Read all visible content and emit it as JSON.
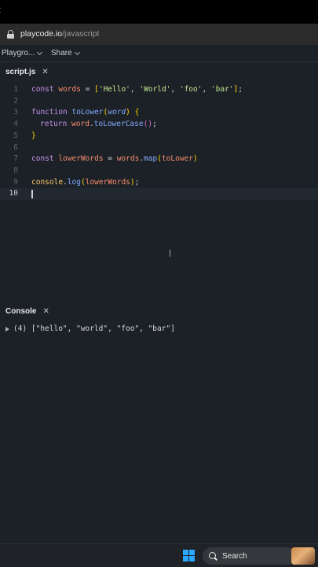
{
  "browser": {
    "back_glyph": "‹",
    "url_host": "playcode.io",
    "url_path": "/javascript"
  },
  "nav": {
    "playground_label": "Playgro...",
    "share_label": "Share"
  },
  "tab": {
    "filename": "script.js",
    "close_glyph": "✕"
  },
  "editor": {
    "line_numbers": [
      "1",
      "2",
      "3",
      "4",
      "5",
      "6",
      "7",
      "8",
      "9",
      "10"
    ],
    "active_line": 10,
    "code": {
      "line1": {
        "kw": "const",
        "name": " words ",
        "eq": "= ",
        "open": "[",
        "s1": "'Hello'",
        "c1": ", ",
        "s2": "'World'",
        "c2": ", ",
        "s3": "'foo'",
        "c3": ", ",
        "s4": "'bar'",
        "close": "]",
        "end": ";"
      },
      "line3": {
        "kw": "function",
        "fn": " toLower",
        "p_open": "(",
        "param": "word",
        "p_close": ")",
        "brace": " {"
      },
      "line4": {
        "kw": "return",
        "obj": " word",
        "dot": ".",
        "method": "toLowerCase",
        "call": "()",
        "end": ";"
      },
      "line5": {
        "brace": "}"
      },
      "line7": {
        "kw": "const",
        "name": " lowerWords",
        "eq": " = ",
        "obj": "words",
        "dot": ".",
        "method": "map",
        "p_open": "(",
        "arg": "toLower",
        "p_close": ")"
      },
      "line9": {
        "obj": "console",
        "dot": ".",
        "method": "log",
        "p_open": "(",
        "arg": "lowerWords",
        "p_close": ")",
        "end": ";"
      }
    }
  },
  "console": {
    "title": "Console",
    "close_glyph": "✕",
    "output": "(4) [\"hello\", \"world\", \"foo\", \"bar\"]"
  },
  "taskbar": {
    "search_label": "Search"
  },
  "colors": {
    "editor_bg": "#1c2127",
    "keyword": "#c792ea",
    "function": "#82aaff",
    "string": "#c3e88d",
    "variable": "#f78c6c"
  }
}
